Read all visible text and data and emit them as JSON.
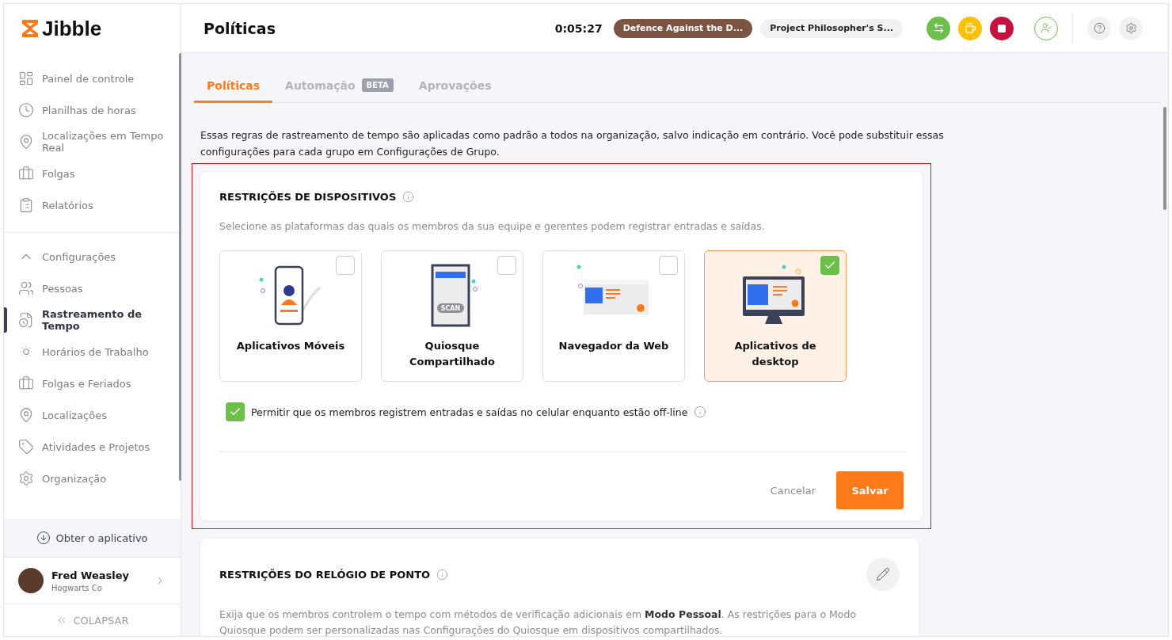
{
  "logo": {
    "text": "Jibble"
  },
  "sidebar": {
    "items": [
      {
        "label": "Painel de controle",
        "selected": false
      },
      {
        "label": "Planilhas de horas",
        "selected": false
      },
      {
        "label": "Localizações em Tempo Real",
        "selected": false
      },
      {
        "label": "Folgas",
        "selected": false
      },
      {
        "label": "Relatórios",
        "selected": false
      }
    ],
    "settings": {
      "label": "Configurações",
      "expanded": true,
      "children": [
        {
          "label": "Pessoas",
          "selected": false
        },
        {
          "label": "Rastreamento de Tempo",
          "selected": true
        },
        {
          "label": "Horários de Trabalho",
          "selected": false
        },
        {
          "label": "Folgas e Feriados",
          "selected": false
        },
        {
          "label": "Localizações",
          "selected": false
        },
        {
          "label": "Atividades e Projetos",
          "selected": false
        },
        {
          "label": "Organização",
          "selected": false
        }
      ]
    },
    "get_app": "Obter o aplicativo",
    "user": {
      "name": "Fred Weasley",
      "company": "Hogwarts Co"
    },
    "collapse": "COLAPSAR"
  },
  "header": {
    "title": "Políticas",
    "timer": "0:05:27",
    "activity": "Defence Against the D...",
    "project": "Project Philosopher's S..."
  },
  "tabs": [
    {
      "label": "Políticas",
      "selected": true
    },
    {
      "label": "Automação",
      "badge": "BETA",
      "selected": false
    },
    {
      "label": "Aprovações",
      "selected": false
    }
  ],
  "intro": "Essas regras de rastreamento de tempo são aplicadas como padrão a todos na organização, salvo indicação em contrário. Você pode substituir essas configurações para cada grupo em Configurações de Grupo.",
  "device_card": {
    "title": "RESTRIÇÕES DE DISPOSITIVOS",
    "description": "Selecione as plataformas das quais os membros da sua equipe e gerentes podem registrar entradas e saídas.",
    "platforms": [
      {
        "kind": "mobile",
        "label": "Aplicativos Móveis",
        "checked": false
      },
      {
        "kind": "kiosk",
        "label": "Quiosque Compartilhado",
        "scan_label": "SCAN",
        "checked": false
      },
      {
        "kind": "web",
        "label": "Navegador da Web",
        "checked": false
      },
      {
        "kind": "desktop",
        "label": "Aplicativos de desktop",
        "checked": true
      }
    ],
    "offline": {
      "label": "Permitir que os membros registrem entradas e saídas no celular enquanto estão off-line",
      "checked": true
    },
    "cancel": "Cancelar",
    "save": "Salvar"
  },
  "clock_card": {
    "title": "RESTRIÇÕES DO RELÓGIO DE PONTO",
    "description": "Exija que os membros controlem o tempo com métodos de verificação adicionais em **Modo Pessoal**. As restrições para o Modo Quiosque podem ser personalizadas nas Configurações do Quiosque em dispositivos compartilhados."
  }
}
